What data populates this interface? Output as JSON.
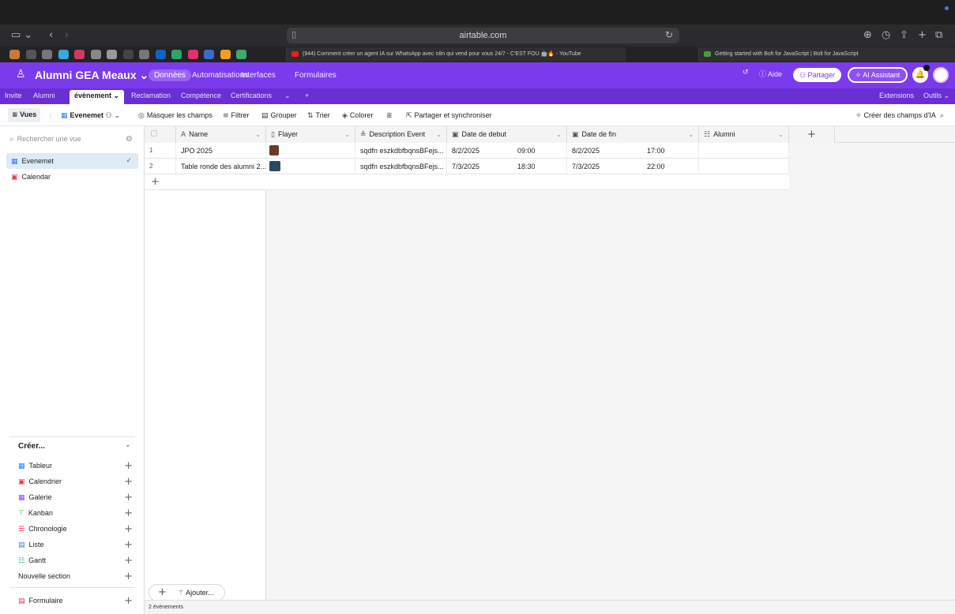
{
  "browser": {
    "url": "airtable.com",
    "tabs": [
      {
        "title": "(944) Comment créer un agent IA sur WhatsApp avec n8n qui vend pour vous 24/7 - C'EST FOU 🤖🔥 - YouTube",
        "icon_color": "#e62117"
      },
      {
        "title": "Getting started with Bolt for JavaScript | Bolt for JavaScript",
        "icon_color": "#4a9b3d"
      }
    ],
    "favorites_colors": [
      "#c97a3a",
      "#555",
      "#777",
      "#3ba6e0",
      "#d03a5f",
      "#888",
      "#999",
      "#444",
      "#777",
      "#0a66c2",
      "#2fa36b",
      "#e1306c",
      "#3b6cc7",
      "#f0a020",
      "#3fa96b"
    ]
  },
  "app": {
    "base_name": "Alumni GEA Meaux",
    "nav": [
      "Données",
      "Automatisations",
      "Interfaces",
      "Formulaires"
    ],
    "help": "Aide",
    "share": "Partager",
    "ai_assistant": "AI Assistant",
    "brand_color": "#7c3aed"
  },
  "tables": [
    "Invite",
    "Alumni",
    "évènement",
    "Reclamation",
    "Compétence",
    "Certifications"
  ],
  "tables_right": [
    "Extensions",
    "Outils"
  ],
  "toolbar": {
    "views": "Vues",
    "current_view": "Evenemet",
    "hide_fields": "Masquer les champs",
    "filter": "Filtrer",
    "group": "Grouper",
    "sort": "Trier",
    "color": "Colorer",
    "share_sync": "Partager et synchroniser",
    "ai_fields": "Créer des champs d'IA"
  },
  "sidebar": {
    "search_placeholder": "Rechercher une vue",
    "views": [
      {
        "label": "Evenemet",
        "icon": "grid-icon",
        "active": true
      },
      {
        "label": "Calendar",
        "icon": "calendar-icon",
        "active": false
      }
    ],
    "create_title": "Créer...",
    "create_items": [
      {
        "label": "Tableur",
        "icon": "grid-icon",
        "color": "#2d7ff9"
      },
      {
        "label": "Calendrier",
        "icon": "calendar-icon",
        "color": "#e8384f"
      },
      {
        "label": "Galerie",
        "icon": "gallery-icon",
        "color": "#8b46ff"
      },
      {
        "label": "Kanban",
        "icon": "kanban-icon",
        "color": "#20c933"
      },
      {
        "label": "Chronologie",
        "icon": "timeline-icon",
        "color": "#f82b60"
      },
      {
        "label": "Liste",
        "icon": "list-icon",
        "color": "#2d7ff9"
      },
      {
        "label": "Gantt",
        "icon": "gantt-icon",
        "color": "#20a99b"
      },
      {
        "label": "Nouvelle section",
        "icon": "",
        "color": "#1d1f25"
      }
    ],
    "form_item": {
      "label": "Formulaire",
      "icon": "form-icon",
      "color": "#e8384f"
    }
  },
  "grid": {
    "columns": [
      {
        "label": "Name",
        "icon": "A"
      },
      {
        "label": "Flayer",
        "icon": "📄"
      },
      {
        "label": "Description Event",
        "icon": "≜"
      },
      {
        "label": "Date de debut",
        "icon": "📅"
      },
      {
        "label": "Date de fin",
        "icon": "📅"
      },
      {
        "label": "Alumni",
        "icon": "☷"
      }
    ],
    "rows": [
      {
        "num": "1",
        "name": "JPO 2025",
        "flayer_color": "#6b3a2a",
        "description": "sqdfn eszkdbfbqnsBFejs...",
        "start_date": "8/2/2025",
        "start_time": "09:00",
        "end_date": "8/2/2025",
        "end_time": "17:00",
        "alumni": ""
      },
      {
        "num": "2",
        "name": "Table ronde des alumni 2...",
        "flayer_color": "#2c4a5e",
        "description": "sqdfn eszkdbfbqnsBFejs...",
        "start_date": "7/3/2025",
        "start_time": "18:30",
        "end_date": "7/3/2025",
        "end_time": "22:00",
        "alumni": ""
      }
    ],
    "record_count": "2 évènements",
    "add_label": "Ajouter..."
  }
}
